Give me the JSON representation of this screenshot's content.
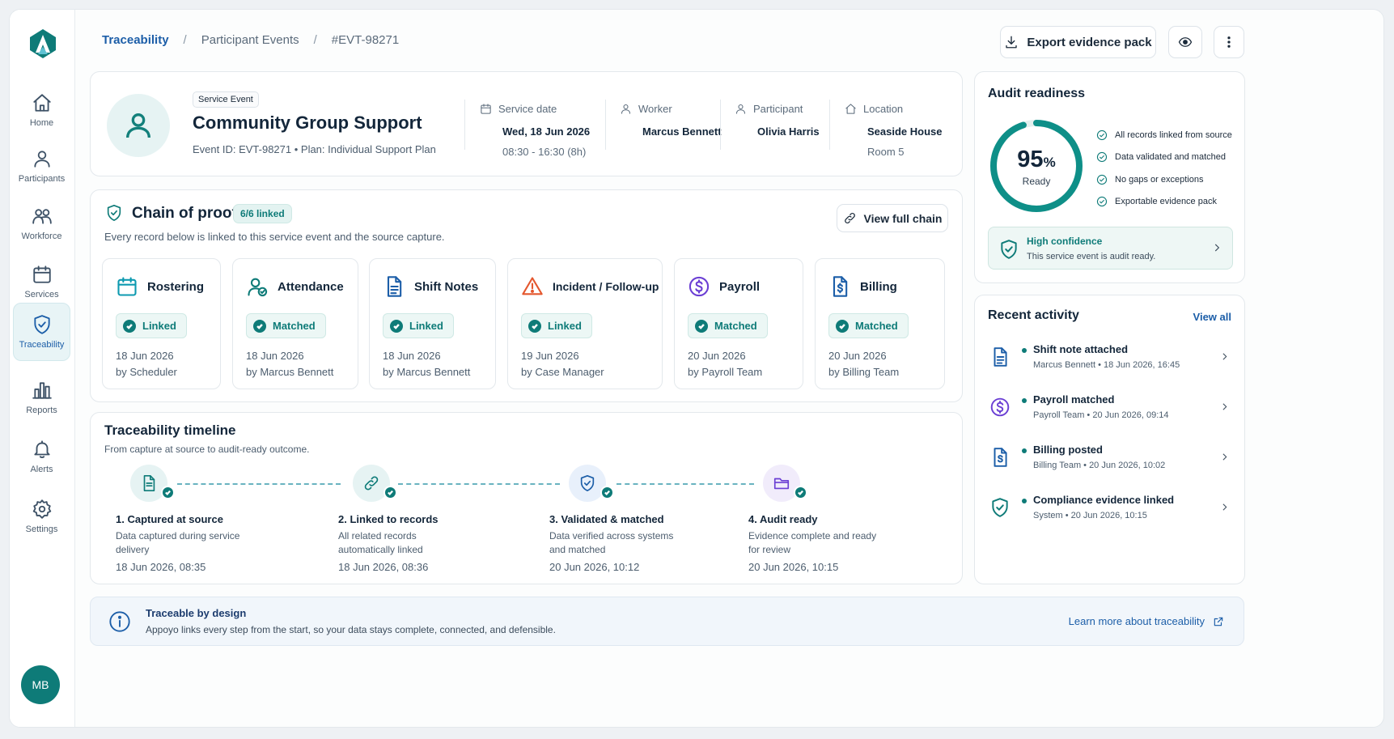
{
  "nav": {
    "items": [
      {
        "label": "Home",
        "icon": "home-icon"
      },
      {
        "label": "Participants",
        "icon": "person-icon"
      },
      {
        "label": "Workforce",
        "icon": "people-icon"
      },
      {
        "label": "Services",
        "icon": "calendar-icon"
      },
      {
        "label": "Traceability",
        "icon": "shield-icon",
        "active": true
      },
      {
        "label": "Reports",
        "icon": "bar-chart-icon"
      },
      {
        "label": "Alerts",
        "icon": "bell-icon"
      },
      {
        "label": "Settings",
        "icon": "gear-icon"
      }
    ],
    "avatar_initials": "MB"
  },
  "breadcrumb": {
    "root": "Traceability",
    "section": "Participant Events",
    "current": "#EVT-98271",
    "separator": "/"
  },
  "toolbar": {
    "export_label": "Export evidence pack"
  },
  "event": {
    "type_badge": "Service Event",
    "title": "Community Group Support",
    "subtitle": "Event ID: EVT-98271  •  Plan: Individual Support Plan",
    "service_date_label": "Service date",
    "service_date": "Wed, 18 Jun 2026",
    "service_time": "08:30 - 16:30 (8h)",
    "worker_label": "Worker",
    "worker": "Marcus Bennett",
    "participant_label": "Participant",
    "participant": "Olivia Harris",
    "location_label": "Location",
    "location": "Seaside House",
    "room": "Room 5"
  },
  "chain": {
    "title": "Chain of proof",
    "linked_badge": "6/6 linked",
    "subtitle": "Every record below is linked to this service event and the source capture.",
    "view_button": "View full chain",
    "records": [
      {
        "title": "Rostering",
        "status": "Linked",
        "date": "18 Jun 2026",
        "by": "by Scheduler"
      },
      {
        "title": "Attendance",
        "status": "Matched",
        "date": "18 Jun 2026",
        "by": "by Marcus Bennett"
      },
      {
        "title": "Shift Notes",
        "status": "Linked",
        "date": "18 Jun 2026",
        "by": "by Marcus Bennett"
      },
      {
        "title": "Incident / Follow-up",
        "status": "Linked",
        "date": "19 Jun 2026",
        "by": "by Case Manager"
      },
      {
        "title": "Payroll",
        "status": "Matched",
        "date": "20 Jun 2026",
        "by": "by Payroll Team"
      },
      {
        "title": "Billing",
        "status": "Matched",
        "date": "20 Jun 2026",
        "by": "by Billing Team"
      }
    ]
  },
  "timeline": {
    "title": "Traceability timeline",
    "subtitle": "From capture at source to audit-ready outcome.",
    "steps": [
      {
        "name": "1. Captured at source",
        "desc": "Data captured during service delivery",
        "time": "18 Jun 2026, 08:35"
      },
      {
        "name": "2. Linked to records",
        "desc": "All related records automatically linked",
        "time": "18 Jun 2026, 08:36"
      },
      {
        "name": "3. Validated & matched",
        "desc": "Data verified across systems and matched",
        "time": "20 Jun 2026, 10:12"
      },
      {
        "name": "4. Audit ready",
        "desc": "Evidence complete and ready for review",
        "time": "20 Jun 2026, 10:15"
      }
    ]
  },
  "banner": {
    "title": "Traceable by design",
    "text": "Appoyo links every step from the start, so your data stays complete, connected, and defensible.",
    "link": "Learn more about traceability"
  },
  "audit": {
    "title": "Audit readiness",
    "percent_number": "95",
    "percent_sign": "%",
    "percent_value": 95,
    "ready_label": "Ready",
    "checks": [
      "All records linked from source",
      "Data validated and matched",
      "No gaps or exceptions",
      "Exportable evidence pack"
    ],
    "confidence_title": "High confidence",
    "confidence_text": "This service event is audit ready."
  },
  "activity": {
    "title": "Recent activity",
    "view_all": "View all",
    "items": [
      {
        "title": "Shift note attached",
        "meta": "Marcus Bennett  •  18 Jun 2026, 16:45",
        "icon": "document-icon"
      },
      {
        "title": "Payroll matched",
        "meta": "Payroll Team  •  20 Jun 2026, 09:14",
        "icon": "dollar-icon"
      },
      {
        "title": "Billing posted",
        "meta": "Billing Team  •  20 Jun 2026, 10:02",
        "icon": "invoice-icon"
      },
      {
        "title": "Compliance evidence linked",
        "meta": "System  •  20 Jun 2026, 10:15",
        "icon": "shield-check-icon"
      }
    ]
  },
  "colors": {
    "accent_teal": "#0e7b78",
    "link_blue": "#1c5ea8",
    "warning_orange": "#e4572e",
    "purple": "#6b3fd4"
  }
}
